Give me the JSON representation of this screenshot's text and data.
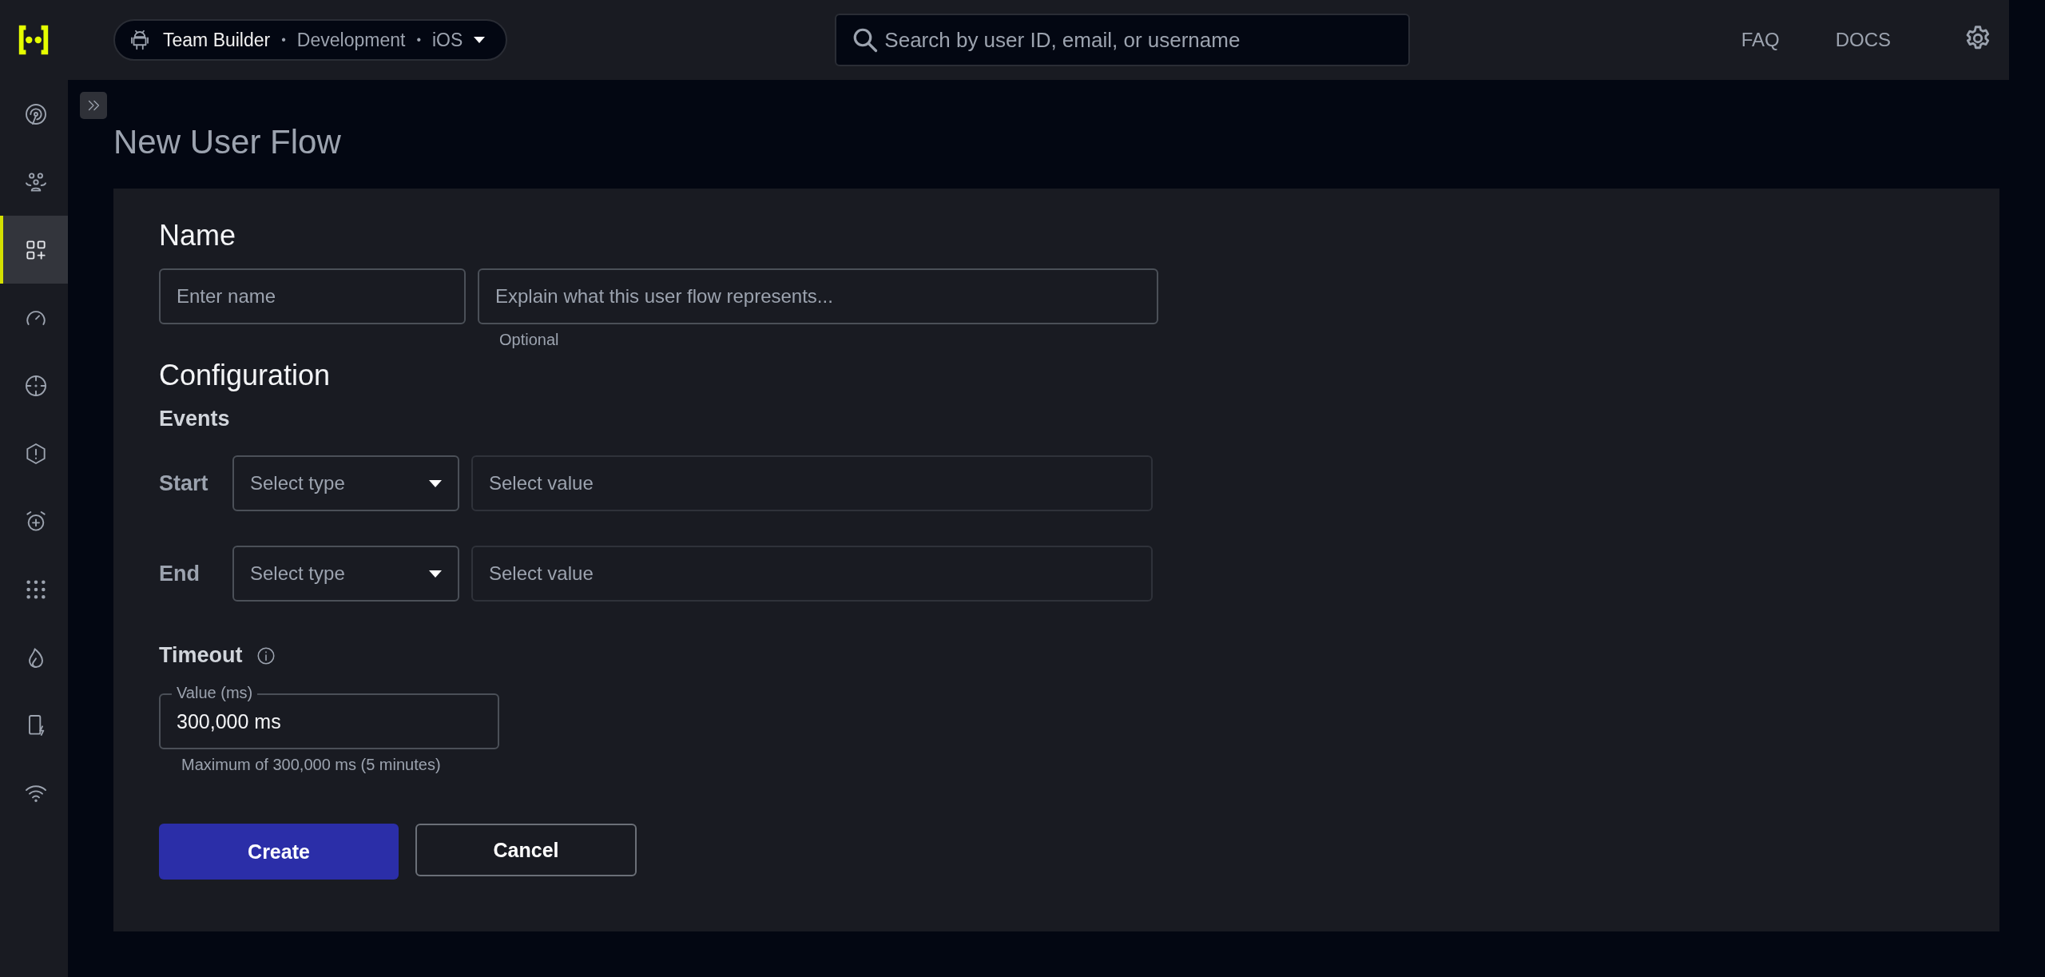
{
  "top_bar": {
    "project": {
      "name": "Team Builder",
      "environment": "Development",
      "platform": "iOS",
      "separators": [
        "•",
        "•"
      ]
    },
    "search": {
      "placeholder": "Search by user ID, email, or username"
    },
    "links": [
      "FAQ",
      "DOCS"
    ]
  },
  "sidebar": {
    "items": [
      {
        "selected": false
      },
      {
        "selected": false
      },
      {
        "selected": true
      },
      {
        "selected": false
      },
      {
        "selected": false
      },
      {
        "selected": false
      },
      {
        "selected": false
      },
      {
        "selected": false
      },
      {
        "selected": false
      },
      {
        "selected": false
      },
      {
        "selected": false
      }
    ]
  },
  "page": {
    "title": "New User Flow"
  },
  "form": {
    "name_section": {
      "heading": "Name",
      "name_field": {
        "placeholder": "Enter name"
      },
      "description_field": {
        "placeholder": "Explain what this user flow represents...",
        "helper": "Optional"
      }
    },
    "configuration": {
      "heading": "Configuration",
      "events_heading": "Events",
      "events": [
        {
          "label": "Start",
          "type_select": {
            "placeholder": "Select type"
          },
          "value_field": {
            "placeholder": "Select value"
          }
        },
        {
          "label": "End",
          "type_select": {
            "placeholder": "Select type"
          },
          "value_field": {
            "placeholder": "Select value"
          }
        }
      ]
    },
    "timeout": {
      "heading": "Timeout",
      "field": {
        "label": "Value (ms)",
        "value": "300,000 ms"
      },
      "helper": "Maximum of 300,000 ms (5 minutes)"
    },
    "buttons": [
      {
        "label": "Create",
        "kind": "primary"
      },
      {
        "label": "Cancel",
        "kind": "secondary"
      }
    ]
  }
}
